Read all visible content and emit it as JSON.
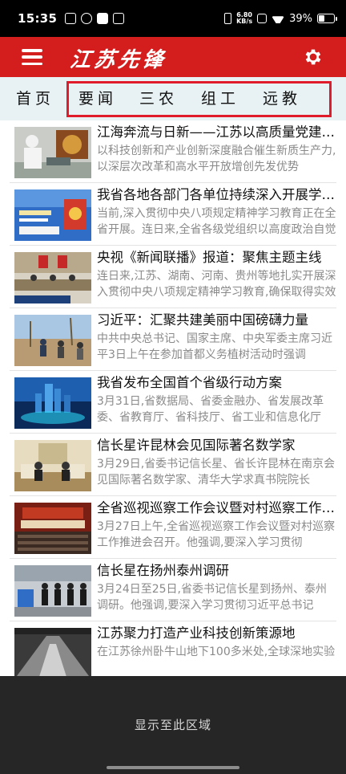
{
  "status_bar": {
    "time": "15:35",
    "net_speed_value": "6.80",
    "net_speed_unit": "KB/s",
    "battery": "39%"
  },
  "header": {
    "logo": "江苏先锋",
    "accent_color": "#d41d1d"
  },
  "tabs": [
    {
      "label": "首页"
    },
    {
      "label": "要闻"
    },
    {
      "label": "三农"
    },
    {
      "label": "组工"
    },
    {
      "label": "远教"
    }
  ],
  "news": [
    {
      "title": "江海奔流与日新——江苏以高质量党建引领高质量发展",
      "summary": "以科技创新和产业创新深度融合催生新质生产力,以深层次改革和高水平开放增创先发优势",
      "thumb": "lab"
    },
    {
      "title": "我省各地各部门各单位持续深入开展学习教育",
      "summary": "当前,深入贯彻中央八项规定精神学习教育正在全省开展。连日来,全省各级党组织以高度政治自觉",
      "thumb": "poster"
    },
    {
      "title": "央视《新闻联播》报道：聚焦主题主线",
      "summary": "连日来,江苏、湖南、河南、贵州等地扎实开展深入贯彻中央八项规定精神学习教育,确保取得实效",
      "thumb": "meeting"
    },
    {
      "title": "习近平：汇聚共建美丽中国磅礴力量",
      "summary": "中共中央总书记、国家主席、中央军委主席习近平3日上午在参加首都义务植树活动时强调",
      "thumb": "trees"
    },
    {
      "title": "我省发布全国首个省级行动方案",
      "summary": "3月31日,省数据局、省委金融办、省发展改革委、省教育厅、省科技厅、省工业和信息化厅",
      "thumb": "city"
    },
    {
      "title": "信长星许昆林会见国际著名数学家",
      "summary": "3月29日,省委书记信长星、省长许昆林在南京会见国际著名数学家、清华大学求真书院院长",
      "thumb": "reception"
    },
    {
      "title": "全省巡视巡察工作会议暨对村巡察工作推进会召开",
      "summary": "3月27日上午,全省巡视巡察工作会议暨对村巡察工作推进会召开。他强调,要深入学习贯彻",
      "thumb": "hall"
    },
    {
      "title": "信长星在扬州泰州调研",
      "summary": "3月24日至25日,省委书记信长星到扬州、泰州调研。他强调,要深入学习贯彻习近平总书记",
      "thumb": "factory"
    },
    {
      "title": "江苏聚力打造产业科技创新策源地",
      "summary": "在江苏徐州卧牛山地下100多米处,全球深地实验",
      "thumb": "tunnel"
    }
  ],
  "bottom_label": "显示至此区域"
}
